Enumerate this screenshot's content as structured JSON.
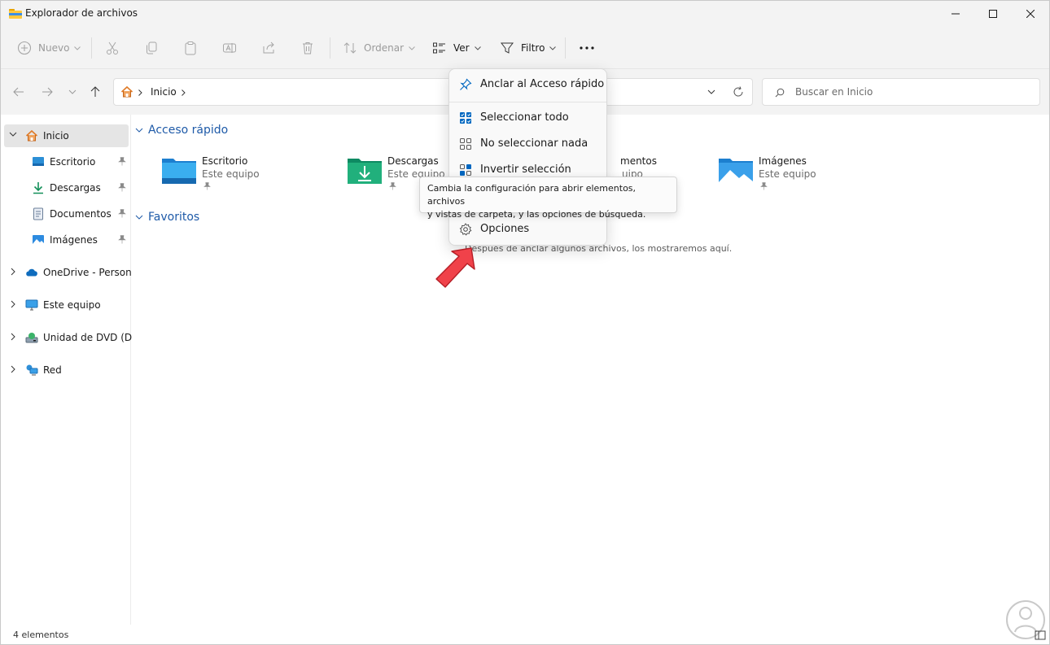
{
  "window": {
    "title": "Explorador de archivos"
  },
  "toolbar": {
    "new_label": "Nuevo",
    "sort_label": "Ordenar",
    "view_label": "Ver",
    "filter_label": "Filtro"
  },
  "address": {
    "crumb": "Inicio",
    "search_placeholder": "Buscar en Inicio"
  },
  "sidebar": {
    "items": [
      {
        "label": "Inicio"
      },
      {
        "label": "Escritorio"
      },
      {
        "label": "Descargas"
      },
      {
        "label": "Documentos"
      },
      {
        "label": "Imágenes"
      },
      {
        "label": "OneDrive - Personal"
      },
      {
        "label": "Este equipo"
      },
      {
        "label": "Unidad de DVD (D:)"
      },
      {
        "label": "Red"
      }
    ]
  },
  "main": {
    "quick_access_title": "Acceso rápido",
    "favorites_title": "Favoritos",
    "favorites_empty": "Después de anclar algunos archivos, los mostraremos aquí.",
    "tiles": [
      {
        "name": "Escritorio",
        "location": "Este equipo"
      },
      {
        "name": "Descargas",
        "location": "Este equipo"
      },
      {
        "name": "mentos",
        "location": "uipo"
      },
      {
        "name": "Imágenes",
        "location": "Este equipo"
      }
    ]
  },
  "menu": {
    "items": [
      {
        "label": "Anclar al Acceso rápido",
        "icon": "pin-icon"
      },
      {
        "label": "Seleccionar todo",
        "icon": "select-all-icon"
      },
      {
        "label": "No seleccionar nada",
        "icon": "select-none-icon"
      },
      {
        "label": "Invertir selección",
        "icon": "invert-selection-icon"
      },
      {
        "label": "Opciones",
        "icon": "gear-icon"
      }
    ]
  },
  "tooltip": {
    "line1": "Cambia la configuración para abrir elementos, archivos",
    "line2": "y vistas de carpeta, y las opciones de búsqueda."
  },
  "status": {
    "items_count": "4 elementos"
  },
  "colors": {
    "accent": "#0067c0",
    "arrow": "#e8323c",
    "folder": "#ffc83d"
  }
}
